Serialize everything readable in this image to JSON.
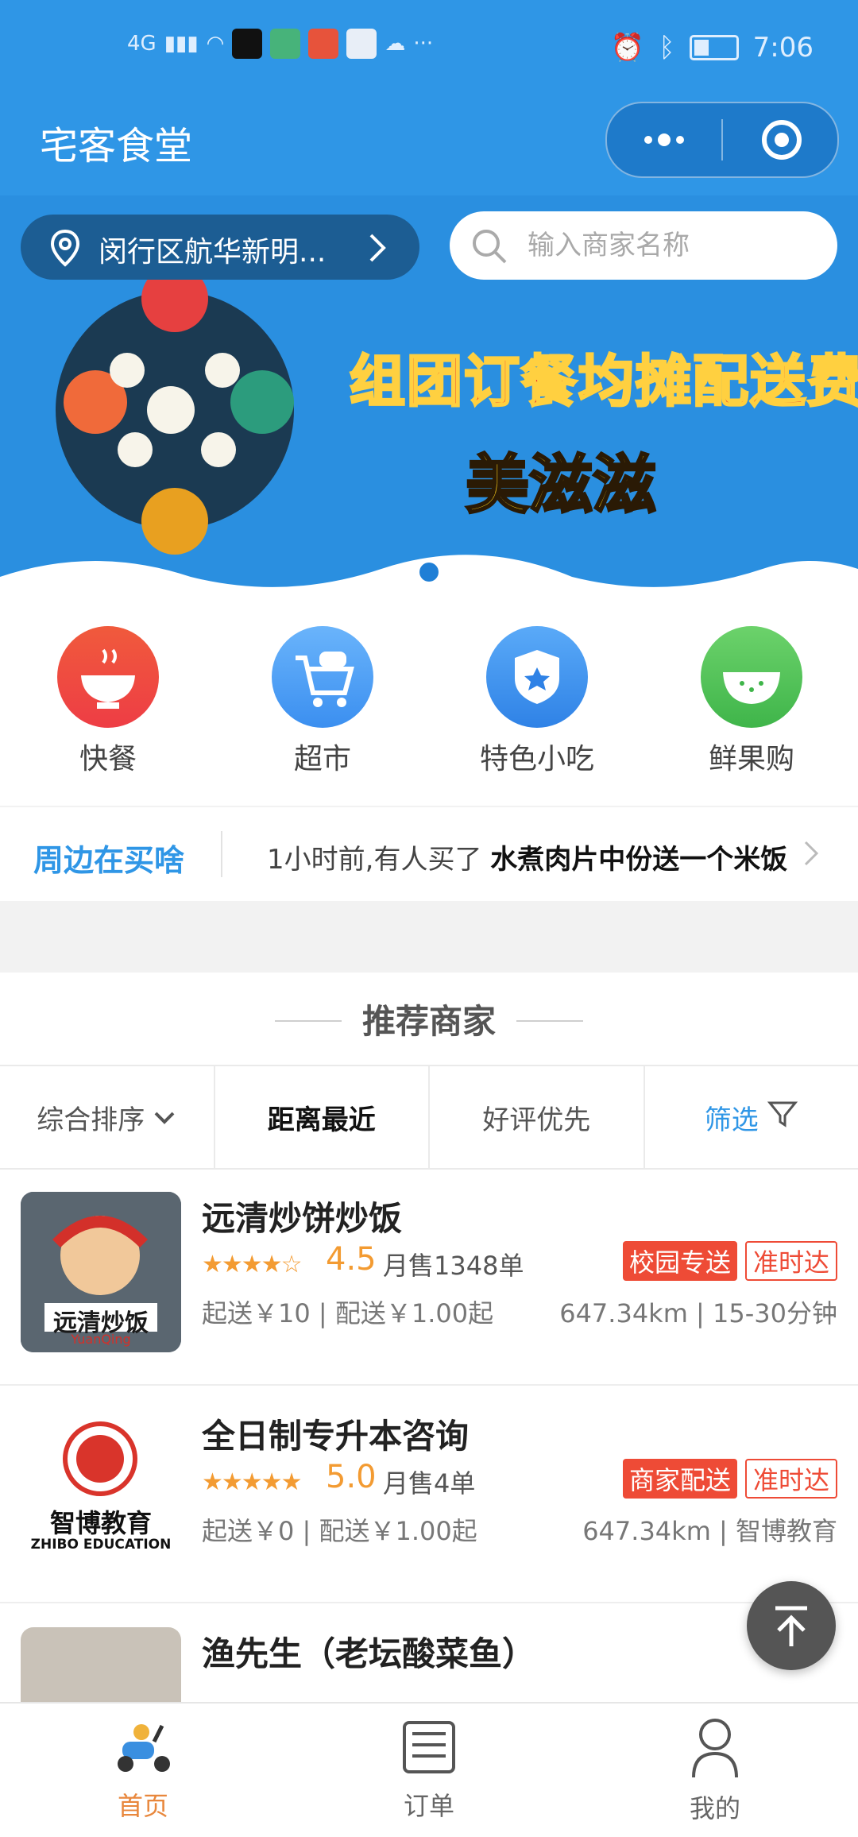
{
  "status_bar": {
    "time": "7:06",
    "network": "4G"
  },
  "header": {
    "title": "宅客食堂",
    "more_icon": "more-dots-icon",
    "target_icon": "target-icon"
  },
  "location": {
    "text": "闵行区航华新明..."
  },
  "search": {
    "placeholder": "输入商家名称"
  },
  "banner": {
    "line1": "组团订餐均摊配送费",
    "line2": "美滋滋"
  },
  "categories": [
    {
      "label": "快餐",
      "icon": "bowl-icon",
      "color": "#f2493c"
    },
    {
      "label": "超市",
      "icon": "cart-icon",
      "color": "#4a98f0"
    },
    {
      "label": "特色小吃",
      "icon": "shield-star-icon",
      "color": "#3e90ea"
    },
    {
      "label": "鲜果购",
      "icon": "watermelon-icon",
      "color": "#56c35a"
    }
  ],
  "ticker": {
    "label": "周边在买啥",
    "prefix": "1小时前,有人买了 ",
    "item": "水煮肉片中份送一个米饭"
  },
  "section": {
    "title": "推荐商家"
  },
  "filters": [
    {
      "label": "综合排序"
    },
    {
      "label": "距离最近"
    },
    {
      "label": "好评优先"
    },
    {
      "label": "筛选"
    }
  ],
  "shops": [
    {
      "name": "远清炒饼炒饭",
      "rating": "4.5",
      "rating_value": 4.5,
      "sales": "月售1348单",
      "tag1": "校园专送",
      "tag2": "准时达",
      "fee": "起送￥10 | 配送￥1.00起",
      "meta": "647.34km | 15-30分钟",
      "logo_text": "远清炒饭",
      "logo_sub": "YuanQing"
    },
    {
      "name": "全日制专升本咨询",
      "rating": "5.0",
      "rating_value": 5.0,
      "sales": "月售4单",
      "tag1": "商家配送",
      "tag2": "准时达",
      "fee": "起送￥0 | 配送￥1.00起",
      "meta": "647.34km | 智博教育",
      "logo_text": "智博教育",
      "logo_sub": "ZHIBO EDUCATION"
    },
    {
      "name": "渔先生（老坛酸菜鱼）",
      "rating": "",
      "sales": "",
      "tag1": "",
      "tag2": ""
    }
  ],
  "tabbar": [
    {
      "label": "首页",
      "icon": "scooter-icon"
    },
    {
      "label": "订单",
      "icon": "order-list-icon"
    },
    {
      "label": "我的",
      "icon": "user-icon"
    }
  ],
  "colors": {
    "primary": "#2f96e6",
    "accent": "#f39b32",
    "tag_red": "#ee4b36",
    "tab_active": "#e8873c"
  }
}
